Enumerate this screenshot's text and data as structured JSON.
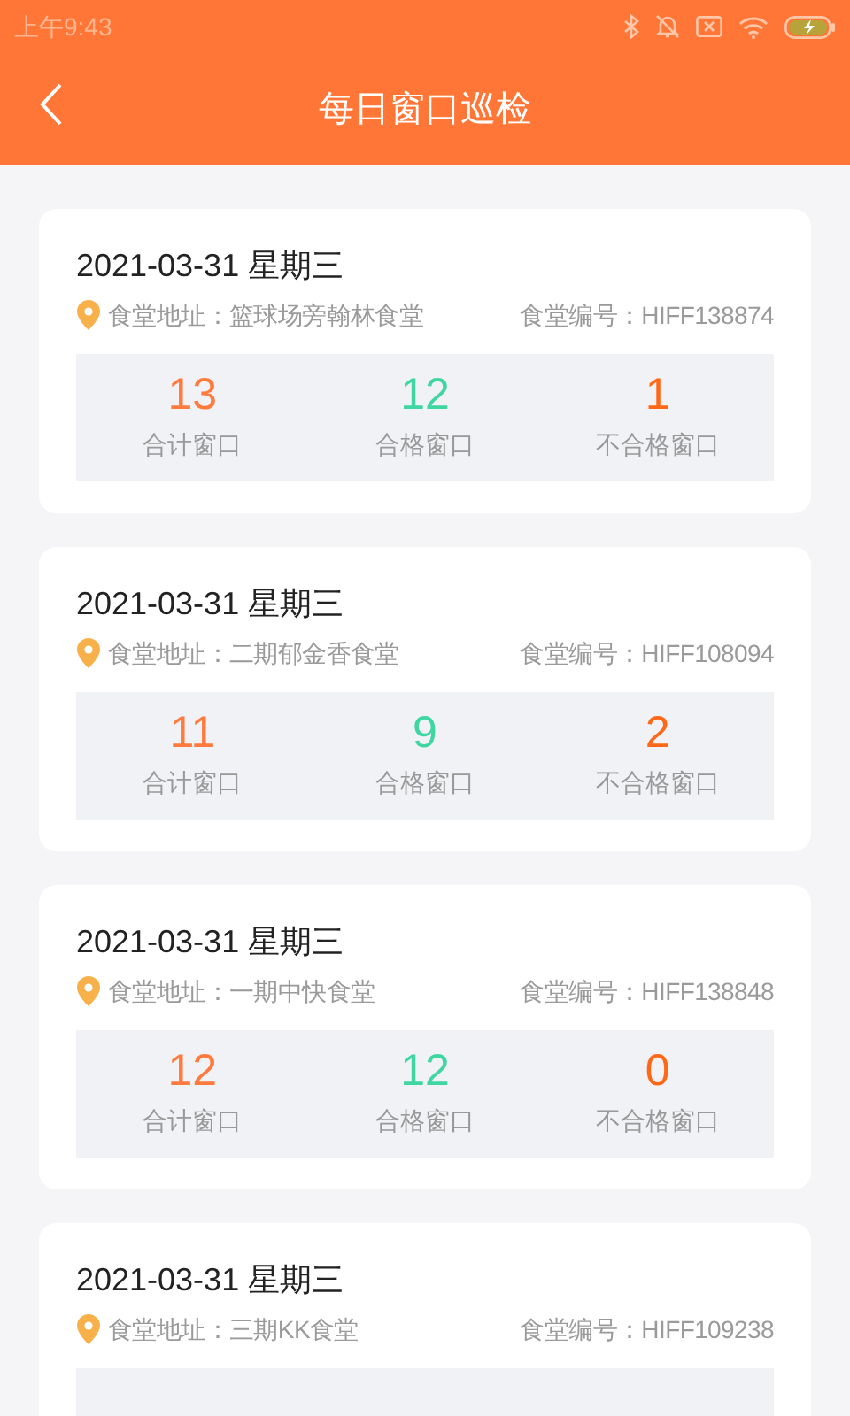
{
  "status_bar": {
    "time": "上午9:43"
  },
  "header": {
    "title": "每日窗口巡检"
  },
  "records": [
    {
      "date": "2021-03-31 星期三",
      "address": "食堂地址：篮球场旁翰林食堂",
      "code": "食堂编号：HIFF138874",
      "stats": [
        {
          "kind": "total",
          "value": "13",
          "label": "合计窗口"
        },
        {
          "kind": "pass",
          "value": "12",
          "label": "合格窗口"
        },
        {
          "kind": "fail",
          "value": "1",
          "label": "不合格窗口"
        }
      ]
    },
    {
      "date": "2021-03-31 星期三",
      "address": "食堂地址：二期郁金香食堂",
      "code": "食堂编号：HIFF108094",
      "stats": [
        {
          "kind": "total",
          "value": "11",
          "label": "合计窗口"
        },
        {
          "kind": "pass",
          "value": "9",
          "label": "合格窗口"
        },
        {
          "kind": "fail",
          "value": "2",
          "label": "不合格窗口"
        }
      ]
    },
    {
      "date": "2021-03-31 星期三",
      "address": "食堂地址：一期中快食堂",
      "code": "食堂编号：HIFF138848",
      "stats": [
        {
          "kind": "total",
          "value": "12",
          "label": "合计窗口"
        },
        {
          "kind": "pass",
          "value": "12",
          "label": "合格窗口"
        },
        {
          "kind": "fail",
          "value": "0",
          "label": "不合格窗口"
        }
      ]
    },
    {
      "date": "2021-03-31 星期三",
      "address": "食堂地址：三期KK食堂",
      "code": "食堂编号：HIFF109238"
    }
  ]
}
